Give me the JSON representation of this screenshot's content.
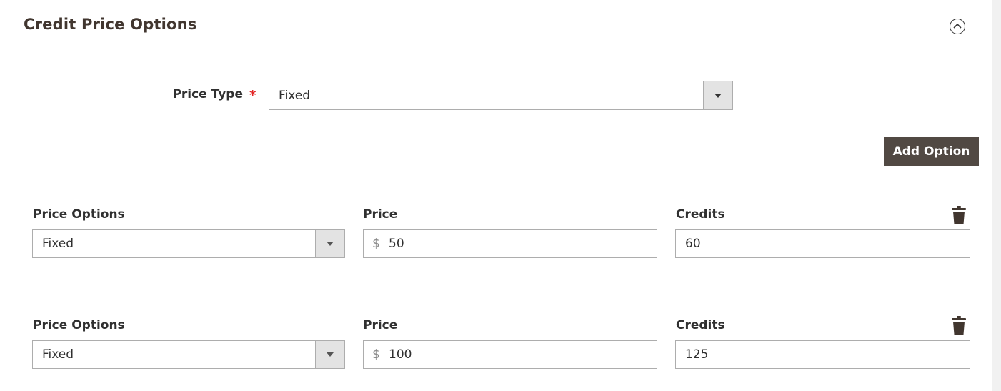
{
  "section": {
    "title": "Credit Price Options",
    "collapse_icon": "chevron-up-circle-icon"
  },
  "price_type": {
    "label": "Price Type",
    "required_marker": "*",
    "selected": "Fixed"
  },
  "add_option_label": "Add Option",
  "options": [
    {
      "price_options_label": "Price Options",
      "price_options_value": "Fixed",
      "price_label": "Price",
      "currency": "$",
      "price_value": "50",
      "credits_label": "Credits",
      "credits_value": "60",
      "delete_icon": "trash-icon"
    },
    {
      "price_options_label": "Price Options",
      "price_options_value": "Fixed",
      "price_label": "Price",
      "currency": "$",
      "price_value": "100",
      "credits_label": "Credits",
      "credits_value": "125",
      "delete_icon": "trash-icon"
    }
  ],
  "colors": {
    "button_bg": "#514943",
    "required": "#e22626",
    "select_arrow_bg": "#e3e3e3",
    "border": "#adadad"
  }
}
